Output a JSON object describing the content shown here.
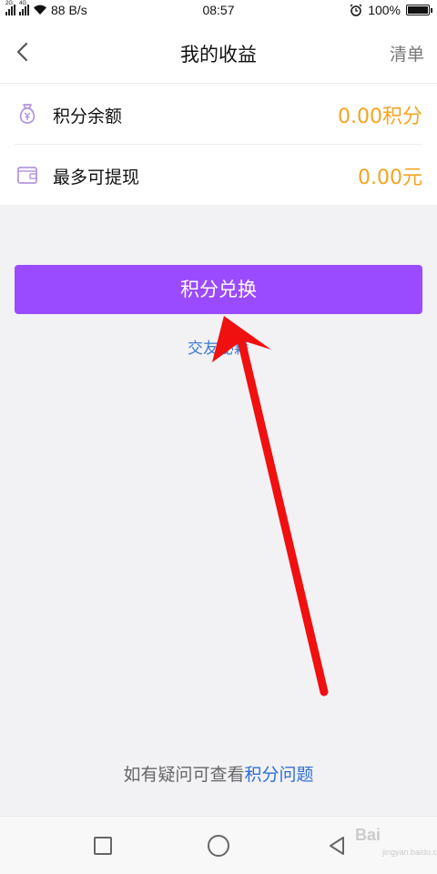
{
  "status_bar": {
    "net_speed": "88 B/s",
    "time": "08:57",
    "battery": "100%",
    "battery_level": 1.0,
    "sim1": "2G",
    "sim2": "4G"
  },
  "header": {
    "title": "我的收益",
    "action_label": "清单"
  },
  "balance": [
    {
      "label": "积分余额",
      "value": "0.00积分",
      "icon": "moneybag-icon"
    },
    {
      "label": "最多可提现",
      "value": "0.00元",
      "icon": "wallet-icon"
    }
  ],
  "exchange_button": {
    "label": "积分兑换"
  },
  "small_link": {
    "label": "交友秘籍"
  },
  "footer": {
    "prefix": "如有疑问可查看",
    "link": "积分问题"
  },
  "watermark": {
    "text": "Bai",
    "sub": "jingyan.baidu.com"
  },
  "colors": {
    "accent": "#9b4bff",
    "value": "#f3a521",
    "link": "#2f6fd4",
    "annotation_arrow": "#f01010"
  }
}
